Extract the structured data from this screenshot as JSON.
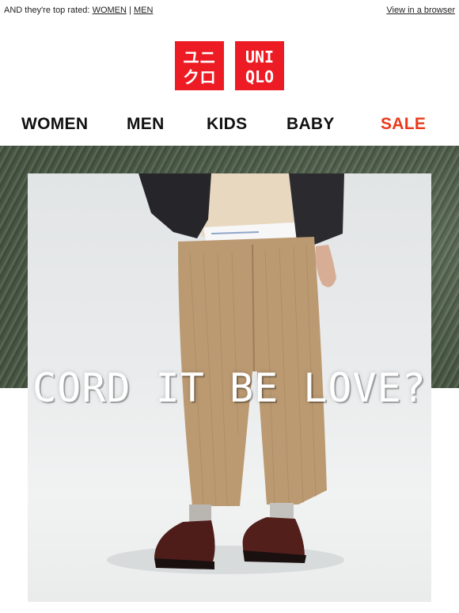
{
  "preheader": {
    "text": "AND they're top rated:",
    "women_link": "WOMEN",
    "separator": "|",
    "men_link": "MEN",
    "browser_link": "View in a browser"
  },
  "logo": {
    "kana_top": "ユニ",
    "kana_bottom": "クロ",
    "latin_top": "UNI",
    "latin_bottom": "QLO",
    "color": "#ed1c24"
  },
  "nav": {
    "items": [
      "WOMEN",
      "MEN",
      "KIDS",
      "BABY",
      "SALE"
    ],
    "sale_color": "#ea3a1b"
  },
  "hero": {
    "headline": "CORD IT BE LOVE?",
    "band_color": "#54654f"
  }
}
